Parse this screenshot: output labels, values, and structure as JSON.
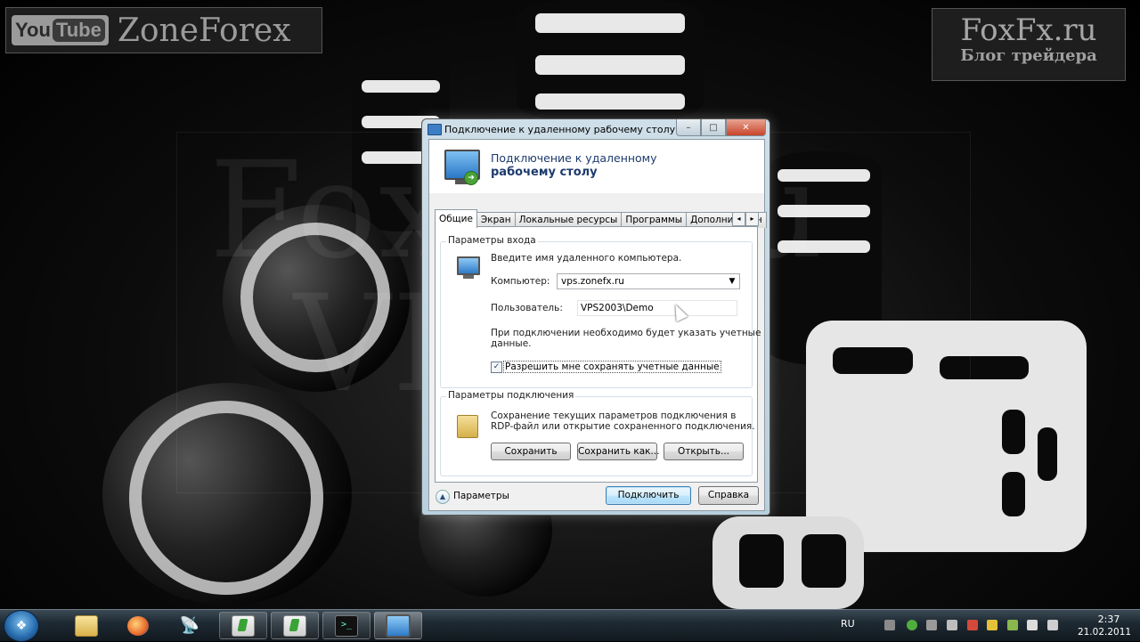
{
  "branding": {
    "youtube_you": "You",
    "youtube_tube": "Tube",
    "channel_name": "ZoneForex",
    "site_name": "FoxFx.ru",
    "site_tagline": "Блог трейдера"
  },
  "window": {
    "title": "Подключение к удаленному рабочему столу",
    "header_line1": "Подключение к удаленному",
    "header_line2": "рабочему столу",
    "caption_minimize": "–",
    "caption_maximize": "□",
    "caption_close": "✕"
  },
  "tabs": [
    {
      "label": "Общие",
      "active": true
    },
    {
      "label": "Экран"
    },
    {
      "label": "Локальные ресурсы"
    },
    {
      "label": "Программы"
    },
    {
      "label": "Дополнительн"
    }
  ],
  "tab_scroll": {
    "left": "◂",
    "right": "▸"
  },
  "login_group": {
    "label": "Параметры входа",
    "instruction": "Введите имя удаленного компьютера.",
    "computer_label": "Компьютер:",
    "computer_value": "vps.zonefx.ru",
    "user_label": "Пользователь:",
    "user_value": "VPS2003\\Demo",
    "note_line1": "При подключении необходимо будет указать учетные",
    "note_line2": "данные.",
    "save_credentials_label": "Разрешить мне сохранять учетные данные",
    "save_credentials_checked": true
  },
  "connection_group": {
    "label": "Параметры подключения",
    "description_line1": "Сохранение текущих параметров подключения в",
    "description_line2": "RDP-файл или открытие сохраненного подключения.",
    "save_button": "Сохранить",
    "save_as_button": "Сохранить как...",
    "open_button": "Открыть..."
  },
  "footer": {
    "options_label": "Параметры",
    "connect_button": "Подключить",
    "help_button": "Справка"
  },
  "taskbar": {
    "language": "RU",
    "time": "2:37",
    "date": "21.02.2011",
    "start_symbol": "❖",
    "items": [
      "explorer-folder",
      "firefox",
      "satellite",
      "green-app-1",
      "green-app-2",
      "terminal",
      "remote-desktop"
    ]
  },
  "watermark": {
    "line1": "FoxFx.ru",
    "line2": "VIDEO"
  }
}
